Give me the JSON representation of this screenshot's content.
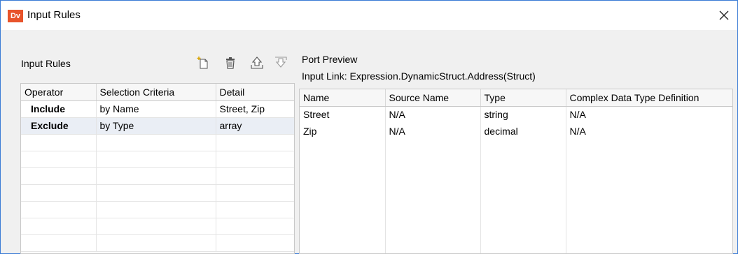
{
  "window": {
    "logo_text": "Dv",
    "title": "Input Rules"
  },
  "left_panel": {
    "title": "Input Rules",
    "toolbar": [
      {
        "icon": "new-rule-icon",
        "tooltip": ""
      },
      {
        "icon": "delete-icon",
        "tooltip": ""
      },
      {
        "icon": "move-up-icon",
        "tooltip": ""
      },
      {
        "icon": "move-down-icon",
        "tooltip": ""
      }
    ],
    "columns": [
      "Operator",
      "Selection Criteria",
      "Detail"
    ],
    "rows": [
      {
        "operator": "Include",
        "criteria": "by Name",
        "detail": "Street, Zip"
      },
      {
        "operator": "Exclude",
        "criteria": "by Type",
        "detail": "array"
      }
    ],
    "selected_row": 1
  },
  "right_panel": {
    "title": "Port Preview",
    "input_link": "Input Link: Expression.DynamicStruct.Address(Struct)",
    "columns": [
      "Name",
      "Source Name",
      "Type",
      "Complex Data Type Definition"
    ],
    "rows": [
      {
        "name": "Street",
        "source": "N/A",
        "type": "string",
        "complex": "N/A"
      },
      {
        "name": "Zip",
        "source": "N/A",
        "type": "decimal",
        "complex": "N/A"
      }
    ]
  },
  "colors": {
    "accent": "#3a7bd5",
    "logo": "#e8542b",
    "selected_row": "#eaeef5"
  }
}
